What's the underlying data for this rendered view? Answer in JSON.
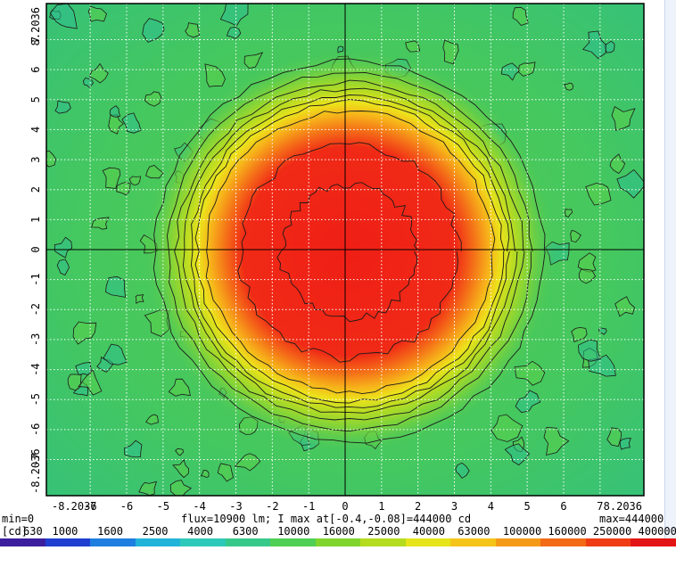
{
  "chart_data": {
    "type": "heatmap",
    "title": "",
    "xlabel": "",
    "ylabel": "",
    "xlim": [
      -8.2036,
      8.2036
    ],
    "ylim": [
      -8.2036,
      8.2036
    ],
    "grid": true,
    "x_ticks": [
      "-8.2036",
      "-7",
      "-6",
      "-5",
      "-4",
      "-3",
      "-2",
      "-1",
      "0",
      "1",
      "2",
      "3",
      "4",
      "5",
      "6",
      "7",
      "8.2036"
    ],
    "x_tick_values": [
      -8.2036,
      -7,
      -6,
      -5,
      -4,
      -3,
      -2,
      -1,
      0,
      1,
      2,
      3,
      4,
      5,
      6,
      7,
      8.2036
    ],
    "y_ticks": [
      "8.2036",
      "7",
      "6",
      "5",
      "4",
      "3",
      "2",
      "1",
      "0",
      "-1",
      "-2",
      "-3",
      "-4",
      "-5",
      "-6",
      "-7",
      "-8.2036"
    ],
    "y_tick_values": [
      8.2036,
      7,
      6,
      5,
      4,
      3,
      2,
      1,
      0,
      -1,
      -2,
      -3,
      -4,
      -5,
      -6,
      -7,
      -8.2036
    ],
    "min_label": "min=0",
    "max_label": "max=444000",
    "flux_label": "flux=10900 lm; I max at[-0.4,-0.08]=444000 cd",
    "peak": {
      "x": -0.4,
      "y": -0.08,
      "value": 444000
    },
    "flux_lm": 10900,
    "unit_label": "[cd]",
    "scale_levels": [
      "630",
      "1000",
      "1600",
      "2500",
      "4000",
      "6300",
      "10000",
      "16000",
      "25000",
      "40000",
      "63000",
      "100000",
      "160000",
      "250000",
      "400000"
    ],
    "scale_colors": [
      "#3c1f9e",
      "#1f3fd0",
      "#1f7fe0",
      "#22b4d8",
      "#2fc9b9",
      "#37c98a",
      "#4fcf55",
      "#7fd52d",
      "#b5dc1e",
      "#e6e41a",
      "#f5c419",
      "#f59a18",
      "#f36a16",
      "#ef3c15",
      "#e31414"
    ]
  }
}
